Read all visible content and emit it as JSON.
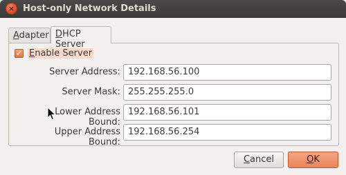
{
  "window": {
    "title": "Host-only Network Details"
  },
  "tabs": [
    {
      "label": "Adapter",
      "mnemonic": "A",
      "rest": "dapter"
    },
    {
      "label": "DHCP Server",
      "mnemonic": "D",
      "rest": "HCP Server"
    }
  ],
  "enable_server": {
    "label": "Enable Server",
    "mnemonic": "E",
    "rest": "nable Server",
    "checked": true
  },
  "fields": [
    {
      "label": "Server Address:",
      "value": "192.168.56.100"
    },
    {
      "label": "Server Mask:",
      "value": "255.255.255.0"
    },
    {
      "label": "Lower Address Bound:",
      "value": "192.168.56.101"
    },
    {
      "label": "Upper Address Bound:",
      "value": "192.168.56.254"
    }
  ],
  "buttons": {
    "cancel": {
      "label": "Cancel",
      "mnemonic": "C",
      "rest": "ancel"
    },
    "ok": {
      "label": "OK",
      "mnemonic": "O",
      "rest": "K"
    }
  },
  "colors": {
    "accent": "#e9855a",
    "titlebar": "#3b3a36"
  }
}
